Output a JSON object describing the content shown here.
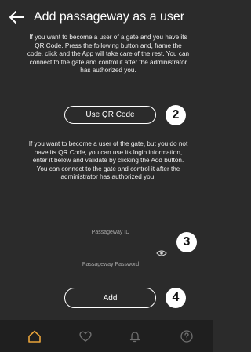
{
  "header": {
    "title": "Add passageway as a user"
  },
  "qr_section": {
    "instructions": "If you want to become a user of a gate and you have its QR Code. Press the following button and, frame the code, click and the App will take care of the rest. You can connect to the gate and control it after the administrator has authorized you.",
    "button_label": "Use QR Code",
    "step_badge": "2"
  },
  "manual_section": {
    "instructions": "If you want to become a user of the gate, but you do not have its QR Code, you can use its login information, enter it below and validate by clicking the Add button. You can connect to the gate and control it after the administrator has authorized you.",
    "step_badge": "3"
  },
  "form": {
    "passageway_id": {
      "label": "Passageway ID",
      "value": ""
    },
    "passageway_password": {
      "label": "Passageway Password",
      "value": ""
    },
    "add_button_label": "Add",
    "add_step_badge": "4"
  },
  "bottom_nav": {
    "items": [
      {
        "icon": "home-icon",
        "active": true
      },
      {
        "icon": "heart-icon",
        "active": false
      },
      {
        "icon": "bell-icon",
        "active": false
      },
      {
        "icon": "help-icon",
        "active": false
      }
    ]
  },
  "colors": {
    "background": "#2b2b2b",
    "navbar_background": "#1f1f1f",
    "accent": "#e8a33a",
    "inactive_icon": "#6f6f6f"
  }
}
